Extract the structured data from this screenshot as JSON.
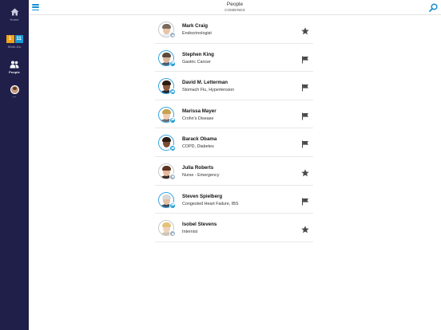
{
  "header": {
    "title": "People",
    "subtitle": "COMBINED"
  },
  "sidebar": {
    "items": [
      {
        "label": "Home",
        "icon": "home-icon",
        "active": false
      },
      {
        "label": "Work-Do",
        "icon": "todo-icon",
        "active": false,
        "badges": [
          "1",
          "11"
        ]
      },
      {
        "label": "People",
        "icon": "people-icon",
        "active": true
      },
      {
        "label": "...",
        "icon": "avatar",
        "active": false
      }
    ]
  },
  "people": [
    {
      "name": "Mark Craig",
      "detail": "Endocrinologist",
      "action": "star-icon",
      "badge": "dot-badge-icon",
      "skin": "#e8c3a6",
      "hair": "#7a6a5d",
      "shirt": "#e9eef3"
    },
    {
      "name": "Stephen King",
      "detail": "Gastric Cancer",
      "action": "flag-icon",
      "badge": "flag-badge-icon",
      "skin": "#d8b49a",
      "hair": "#5b4a3c",
      "shirt": "#4a5b6e"
    },
    {
      "name": "David M. Letterman",
      "detail": "Stomach Flu, Hypertension",
      "action": "flag-icon",
      "badge": "flag-badge-icon",
      "skin": "#8a5b3c",
      "hair": "#2c1c12",
      "shirt": "#1f2a3a"
    },
    {
      "name": "Marissa Mayer",
      "detail": "Crohn's Disease",
      "action": "flag-icon",
      "badge": "flag-badge-icon",
      "skin": "#f0cdb0",
      "hair": "#c9a04f",
      "shirt": "#6d6d6d"
    },
    {
      "name": "Barack Obama",
      "detail": "COPD, Diabetes",
      "action": "flag-icon",
      "badge": "flag-badge-icon",
      "skin": "#7a4e33",
      "hair": "#2a1c14",
      "shirt": "#ffffff"
    },
    {
      "name": "Julia Roberts",
      "detail": "Nurse - Emergency",
      "action": "star-icon",
      "badge": "dot-badge-icon",
      "skin": "#e6b89a",
      "hair": "#5c3420",
      "shirt": "#3b2a24"
    },
    {
      "name": "Steven Spielberg",
      "detail": "Congested Heart Failure, IBS",
      "action": "flag-icon",
      "badge": "flag-badge-icon",
      "skin": "#e4bfa4",
      "hair": "#d8d8d8",
      "shirt": "#3d4a5b"
    },
    {
      "name": "Isobel Stevens",
      "detail": "Internist",
      "action": "star-icon",
      "badge": "dot-badge-icon",
      "skin": "#f0d2b8",
      "hair": "#e3c27a",
      "shirt": "#cfc3b2"
    }
  ],
  "colors": {
    "rail": "#1f1f4a",
    "accent": "#1a8fd0",
    "action_icon": "#4a4a4a"
  }
}
